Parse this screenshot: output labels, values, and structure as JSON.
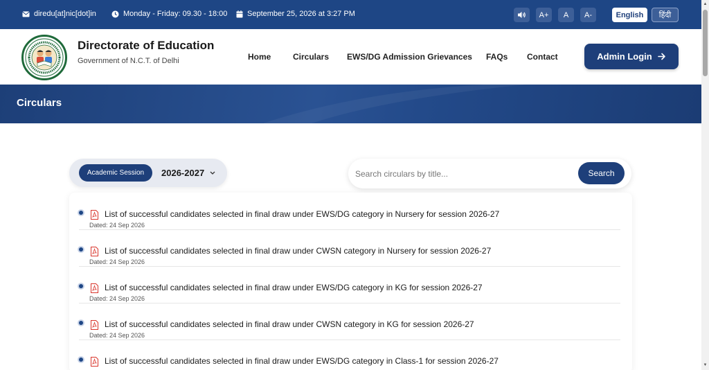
{
  "topbar": {
    "email": "diredu[at]nic[dot]in",
    "hours": "Monday - Friday: 09.30 - 18:00",
    "datetime": "September 25, 2026 at 3:27 PM",
    "font_increase": "A+",
    "font_normal": "A",
    "font_decrease": "A-",
    "lang_english": "English",
    "lang_hindi": "हिंदी",
    "icons": [
      "envelope-icon",
      "clock-icon",
      "calendar-icon",
      "speaker-icon"
    ]
  },
  "header": {
    "title": "Directorate of Education",
    "subtitle": "Government of N.C.T. of Delhi",
    "nav": [
      "Home",
      "Circulars",
      "EWS/DG Admission Grievances",
      "FAQs",
      "Contact"
    ],
    "admin_login": "Admin Login"
  },
  "banner": {
    "title": "Circulars"
  },
  "filters": {
    "session_label": "Academic Session",
    "session_value": "2026-2027",
    "search_placeholder": "Search circulars by title...",
    "search_button": "Search"
  },
  "circulars": [
    {
      "title": "List of successful candidates selected in final draw under EWS/DG category in Nursery for session 2026-27",
      "date": "Dated: 24 Sep 2026"
    },
    {
      "title": "List of successful candidates selected in final draw under CWSN category in Nursery for session 2026-27",
      "date": "Dated: 24 Sep 2026"
    },
    {
      "title": "List of successful candidates selected in final draw under EWS/DG category in KG for session 2026-27",
      "date": "Dated: 24 Sep 2026"
    },
    {
      "title": "List of successful candidates selected in final draw under CWSN category in KG for session 2026-27",
      "date": "Dated: 24 Sep 2026"
    },
    {
      "title": "List of successful candidates selected in final draw under EWS/DG category in Class-1 for session 2026-27",
      "date": ""
    }
  ],
  "colors": {
    "primary": "#1e3f7a",
    "topbar": "#1e4685",
    "pdf_red": "#d9342b"
  }
}
